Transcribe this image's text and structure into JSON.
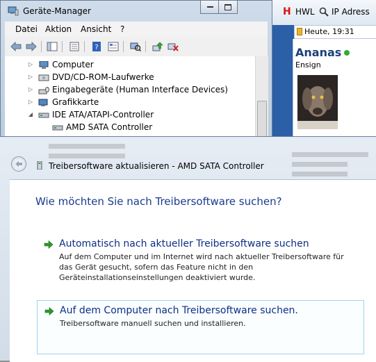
{
  "background_app": {
    "toolbar_items": [
      {
        "icon": "h-logo-icon",
        "label": "HWL"
      },
      {
        "icon": "search-icon",
        "label": "IP Adress"
      }
    ],
    "status_label": "Heute, 19:31",
    "user_name": "Ananas",
    "user_rank": "Ensign",
    "status_color": "#2fae2f"
  },
  "device_manager": {
    "title": "Geräte-Manager",
    "window_buttons": [
      "minimize",
      "maximize"
    ],
    "menu": [
      "Datei",
      "Aktion",
      "Ansicht",
      "?"
    ],
    "toolbar_icons": [
      "back-icon",
      "forward-icon",
      "show-hide-tree-icon",
      "properties-icon",
      "help-icon",
      "view-icon",
      "scan-hardware-icon",
      "update-driver-icon",
      "uninstall-icon"
    ],
    "tree": [
      {
        "label": "Computer",
        "expanded": false,
        "icon": "computer-icon"
      },
      {
        "label": "DVD/CD-ROM-Laufwerke",
        "expanded": false,
        "icon": "dvd-drive-icon"
      },
      {
        "label": "Eingabegeräte (Human Interface Devices)",
        "expanded": false,
        "icon": "hid-icon"
      },
      {
        "label": "Grafikkarte",
        "expanded": false,
        "icon": "display-adapter-icon"
      },
      {
        "label": "IDE ATA/ATAPI-Controller",
        "expanded": true,
        "icon": "ide-controller-icon"
      },
      {
        "label": "AMD SATA Controller",
        "child": true,
        "icon": "controller-device-icon"
      }
    ]
  },
  "wizard": {
    "title": "Treibersoftware aktualisieren - AMD SATA Controller",
    "question": "Wie möchten Sie nach Treibersoftware suchen?",
    "options": [
      {
        "title": "Automatisch nach aktueller Treibersoftware suchen",
        "description": "Auf dem Computer und im Internet wird nach aktueller Treibersoftware für das Gerät gesucht, sofern das Feature nicht in den Geräteinstallationseinstellungen deaktiviert wurde."
      },
      {
        "title": "Auf dem Computer nach Treibersoftware suchen.",
        "description": "Treibersoftware manuell suchen und installieren."
      }
    ],
    "accent_color": "#0d2e86",
    "arrow_color": "#2a9a2a"
  }
}
